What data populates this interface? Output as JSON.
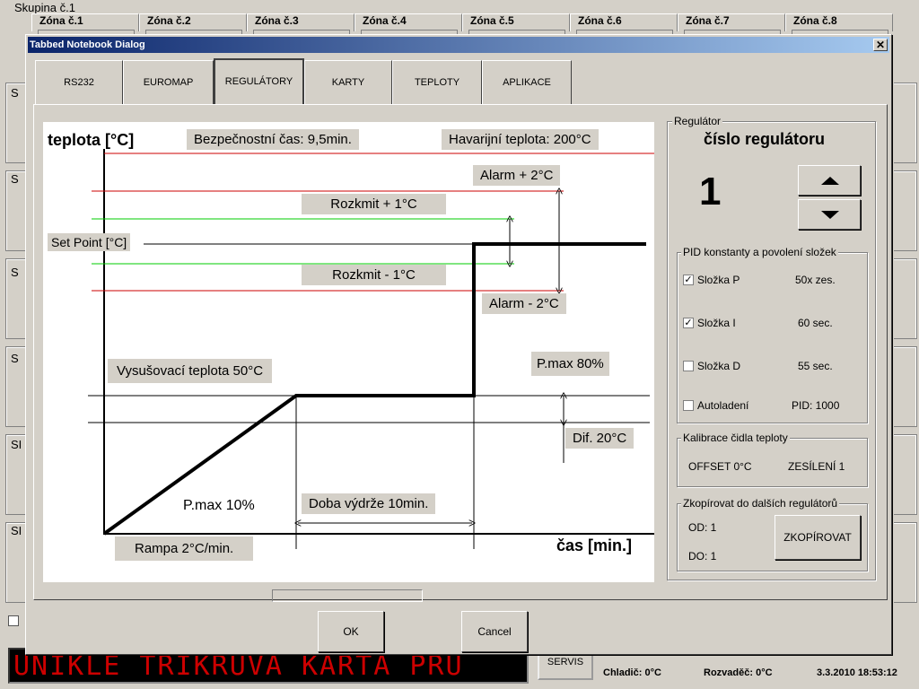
{
  "background": {
    "group_label": "Skupina č.1",
    "zones": [
      "Zóna č.1",
      "Zóna č.2",
      "Zóna č.3",
      "Zóna č.4",
      "Zóna č.5",
      "Zóna č.6",
      "Zóna č.7",
      "Zóna č.8"
    ],
    "side_label": "S",
    "side_label_cut": "SI",
    "ticker_text": "UNIKLE TRIKRUVA KARTA PRU",
    "servis_label": "SERVIS",
    "chladic": "Chladič:  0°C",
    "rozvadec": "Rozvaděč:  0°C",
    "datetime": "3.3.2010 18:53:12"
  },
  "dialog": {
    "title": "Tabbed Notebook Dialog",
    "close": "✕",
    "tabs": [
      "RS232",
      "EUROMAP",
      "REGULÁTORY",
      "KARTY",
      "TEPLOTY",
      "APLIKACE"
    ],
    "active_tab": "REGULÁTORY",
    "ok_label": "OK",
    "cancel_label": "Cancel"
  },
  "diagram": {
    "ylabel": "teplota [°C]",
    "xlabel": "čas [min.]",
    "safety_time": "Bezpečnostní čas:  9,5min.",
    "emergency_temp": "Havarijní teplota:  200°C",
    "alarm_plus": "Alarm + 2°C",
    "rozkmit_plus": "Rozkmit + 1°C",
    "set_point": "Set Point  [°C]",
    "rozkmit_minus": "Rozkmit - 1°C",
    "alarm_minus": "Alarm - 2°C",
    "drying_temp": "Vysušovací teplota  50°C",
    "pmax_80": "P.max  80%",
    "dif": "Dif.  20°C",
    "pmax_10": "P.max  10%",
    "hold_time": "Doba výdrže   10min.",
    "ramp": "Rampa  2°C/min.",
    "colors": {
      "limit_red": "#cc0000",
      "rozkmit_green": "#00cc00",
      "curve": "#000000"
    }
  },
  "regulator": {
    "group_title": "Regulátor",
    "heading": "číslo regulátoru",
    "number": "1",
    "pid_title": "PID konstanty a povolení složek",
    "pid_rows": [
      {
        "label": "Složka P",
        "value": "50x zes.",
        "checked": true
      },
      {
        "label": "Složka I",
        "value": "60 sec.",
        "checked": true
      },
      {
        "label": "Složka D",
        "value": "55 sec.",
        "checked": false
      },
      {
        "label": "Autoladení",
        "value": "PID: 1000",
        "checked": false
      }
    ],
    "calib_title": "Kalibrace čidla teploty",
    "offset": "OFFSET  0°C",
    "gain": "ZESÍLENÍ  1",
    "copy_title": "Zkopírovat do dalších regulátorů",
    "from": "OD:  1",
    "to": "DO:  1",
    "copy_button": "ZKOPÍROVAT"
  }
}
